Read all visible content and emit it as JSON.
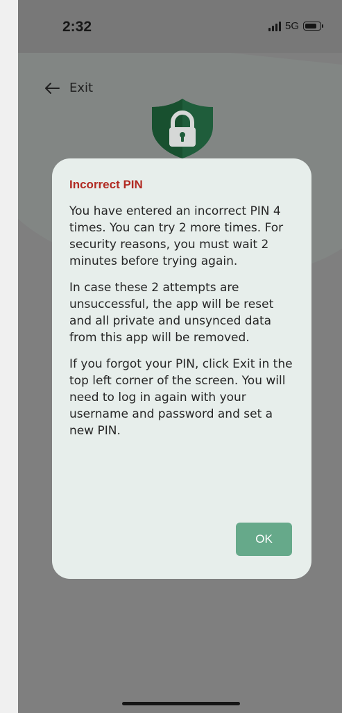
{
  "status_bar": {
    "time": "2:32",
    "network": "5G",
    "icons": [
      "signal-icon",
      "battery-icon"
    ]
  },
  "header": {
    "exit_label": "Exit",
    "back_icon": "arrow-left-icon"
  },
  "hero": {
    "icon": "shield-lock-icon",
    "shield_color": "#1f5d3b"
  },
  "dialog": {
    "title": "Incorrect PIN",
    "paragraphs": [
      "You have entered an incorrect PIN 4 times. You can try 2 more times. For security reasons, you must wait 2 minutes before trying again.",
      "In case these 2 attempts are unsuccessful, the app will be reset and all private and unsynced data from this app will be removed.",
      "If you forgot your PIN, click Exit in the top left corner of the screen. You will need to log in again with your username and password and set a new PIN."
    ],
    "ok_label": "OK"
  },
  "colors": {
    "title": "#b12a22",
    "ok_button": "#66a98a",
    "dialog_bg": "#e7eeeb",
    "overlay": "#7f7f7f"
  }
}
